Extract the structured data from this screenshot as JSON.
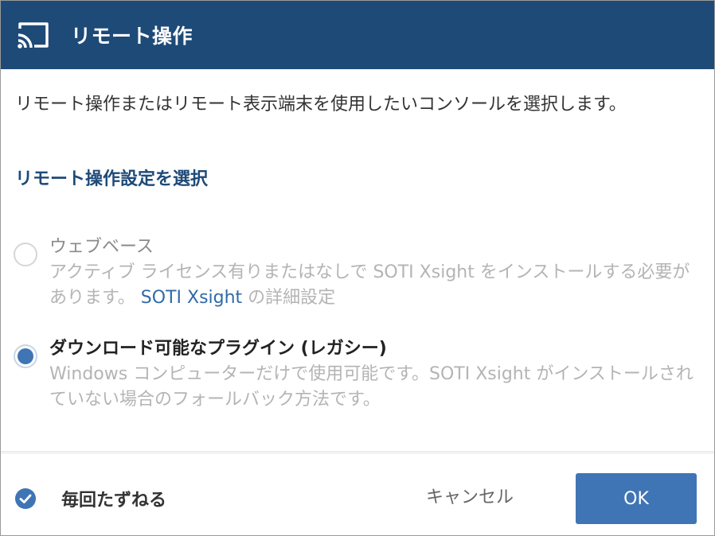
{
  "dialog": {
    "title": "リモート操作",
    "description": "リモート操作またはリモート表示端末を使用したいコンソールを選択します。",
    "section_title": "リモート操作設定を選択"
  },
  "options": [
    {
      "label": "ウェブベース",
      "description_before_link": "アクティブ ライセンス有りまたはなしで SOTI Xsight をインストールする必要があります。 ",
      "link": "SOTI Xsight",
      "description_after_link": " の詳細設定",
      "selected": false
    },
    {
      "label": "ダウンロード可能なプラグイン (レガシー)",
      "description": "Windows コンピューターだけで使用可能です。SOTI Xsight がインストールされていない場合のフォールバック方法です。",
      "selected": true
    }
  ],
  "footer": {
    "ask_every_time_label": "毎回たずねる",
    "ask_every_time_checked": true,
    "cancel_label": "キャンセル",
    "ok_label": "OK"
  },
  "icons": {
    "header": "cast-icon",
    "ask": "check-circle-icon"
  },
  "colors": {
    "header_bg": "#1e4a78",
    "accent": "#3f75b5",
    "link": "#2f6aa8"
  }
}
